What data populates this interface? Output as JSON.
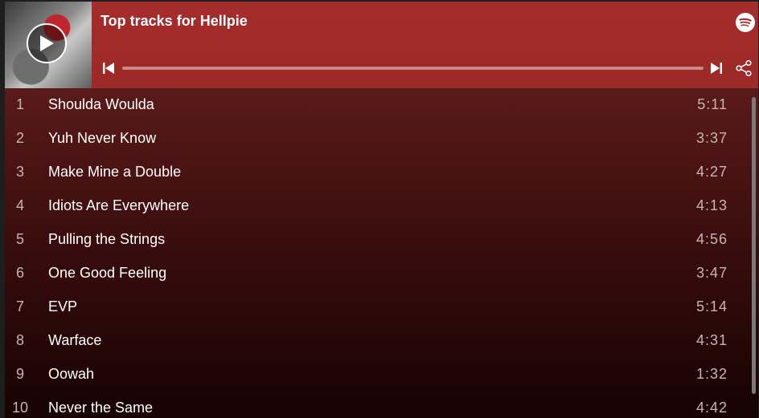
{
  "header": {
    "title": "Top tracks for Hellpie"
  },
  "player": {
    "progress": 0,
    "icons": {
      "play": "play-icon",
      "prev": "skip-previous-icon",
      "next": "skip-next-icon",
      "share": "share-icon",
      "logo": "spotify-icon"
    }
  },
  "tracks": [
    {
      "num": "1",
      "name": "Shoulda Woulda",
      "duration": "5:11"
    },
    {
      "num": "2",
      "name": "Yuh Never Know",
      "duration": "3:37"
    },
    {
      "num": "3",
      "name": "Make Mine a Double",
      "duration": "4:27"
    },
    {
      "num": "4",
      "name": "Idiots Are Everywhere",
      "duration": "4:13"
    },
    {
      "num": "5",
      "name": "Pulling the Strings",
      "duration": "4:56"
    },
    {
      "num": "6",
      "name": "One Good Feeling",
      "duration": "3:47"
    },
    {
      "num": "7",
      "name": "EVP",
      "duration": "5:14"
    },
    {
      "num": "8",
      "name": "Warface",
      "duration": "4:31"
    },
    {
      "num": "9",
      "name": "Oowah",
      "duration": "1:32"
    },
    {
      "num": "10",
      "name": "Never the Same",
      "duration": "4:42"
    }
  ],
  "colors": {
    "header_bg": "#a52c2a",
    "text_primary": "#ffffff",
    "text_secondary": "#c9b4b4"
  }
}
